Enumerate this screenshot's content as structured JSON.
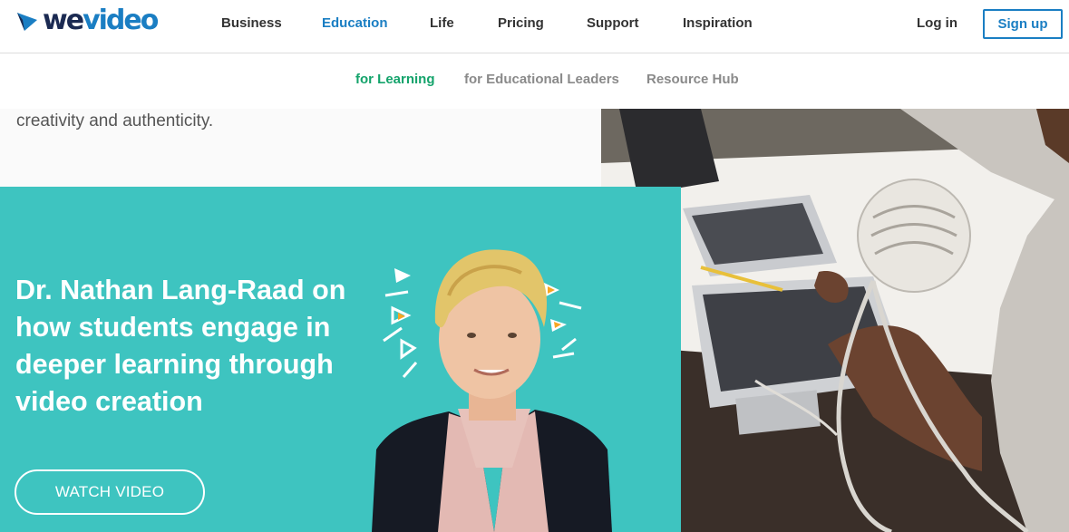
{
  "brand": {
    "logo_text_we": "we",
    "logo_text_video": "video",
    "accent": "#1a7ec3",
    "teal": "#3ec4c0",
    "green": "#14a36b"
  },
  "nav": {
    "items": [
      {
        "label": "Business"
      },
      {
        "label": "Education"
      },
      {
        "label": "Life"
      },
      {
        "label": "Pricing"
      },
      {
        "label": "Support"
      },
      {
        "label": "Inspiration"
      }
    ],
    "active": "Education",
    "login": "Log in",
    "signup": "Sign up"
  },
  "subnav": {
    "items": [
      {
        "label": "for Learning"
      },
      {
        "label": "for Educational Leaders"
      },
      {
        "label": "Resource Hub"
      }
    ],
    "active": "for Learning"
  },
  "intro": {
    "text": "creativity and authenticity."
  },
  "promo": {
    "title": "Dr. Nathan Lang-Raad on how students engage in deeper learning through video creation",
    "button": "WATCH VIDEO"
  },
  "icons": [
    "wevideo-logo-icon",
    "play-triangle-icon"
  ]
}
